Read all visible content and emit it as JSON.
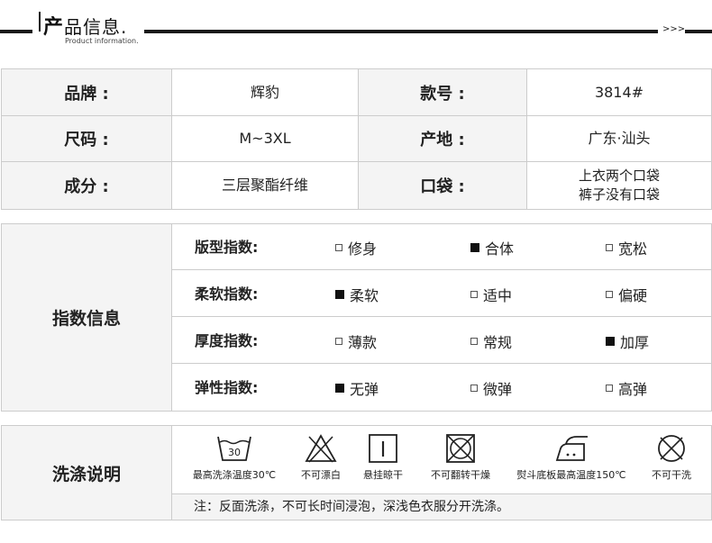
{
  "header": {
    "title_first": "产",
    "title_rest": "品信息",
    "title_dot": ".",
    "subtitle": "Product information.",
    "arrows": ">>>"
  },
  "info": {
    "rows": [
      [
        {
          "label": "品牌 :",
          "value": "辉豹"
        },
        {
          "label": "款号 :",
          "value": "3814#"
        }
      ],
      [
        {
          "label": "尺码 :",
          "value": "M~3XL"
        },
        {
          "label": "产地 :",
          "value": "广东·汕头"
        }
      ],
      [
        {
          "label": "成分 :",
          "value": "三层聚酯纤维"
        },
        {
          "label": "口袋 :",
          "value_lines": [
            "上衣两个口袋",
            "裤子没有口袋"
          ]
        }
      ]
    ]
  },
  "index": {
    "title": "指数信息",
    "rows": [
      {
        "name": "版型指数:",
        "options": [
          {
            "text": "修身",
            "checked": false
          },
          {
            "text": "合体",
            "checked": true
          },
          {
            "text": "宽松",
            "checked": false
          }
        ]
      },
      {
        "name": "柔软指数:",
        "options": [
          {
            "text": "柔软",
            "checked": true
          },
          {
            "text": "适中",
            "checked": false
          },
          {
            "text": "偏硬",
            "checked": false
          }
        ]
      },
      {
        "name": "厚度指数:",
        "options": [
          {
            "text": "薄款",
            "checked": false
          },
          {
            "text": "常规",
            "checked": false
          },
          {
            "text": "加厚",
            "checked": true
          }
        ]
      },
      {
        "name": "弹性指数:",
        "options": [
          {
            "text": "无弹",
            "checked": true
          },
          {
            "text": "微弹",
            "checked": false
          },
          {
            "text": "高弹",
            "checked": false
          }
        ]
      }
    ]
  },
  "wash": {
    "title": "洗涤说明",
    "icons": [
      {
        "icon": "wash-30-icon",
        "label": "最高洗涤温度30℃",
        "temp": "30"
      },
      {
        "icon": "no-bleach-icon",
        "label": "不可漂白"
      },
      {
        "icon": "hang-dry-icon",
        "label": "悬挂晾干"
      },
      {
        "icon": "no-tumble-dry-icon",
        "label": "不可翻转干燥"
      },
      {
        "icon": "iron-icon",
        "label": "熨斗底板最高温度150℃"
      },
      {
        "icon": "no-dry-clean-icon",
        "label": "不可干洗"
      }
    ],
    "note": "注：反面洗涤，不可长时间浸泡，深浅色衣服分开洗涤。"
  }
}
